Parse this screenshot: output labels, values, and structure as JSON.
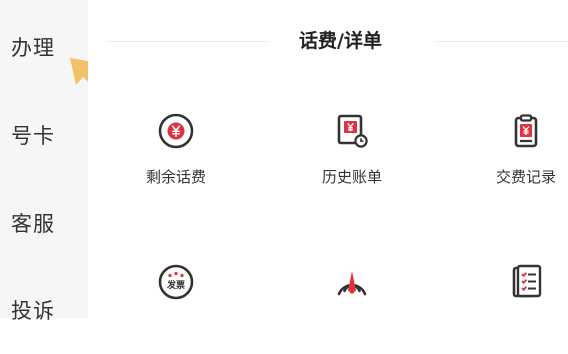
{
  "sidebar": {
    "items": [
      {
        "label": "办理"
      },
      {
        "label": "号卡"
      },
      {
        "label": "客服"
      },
      {
        "label": "投诉"
      }
    ]
  },
  "section": {
    "title": "话费/详单",
    "tiles": [
      {
        "label": "剩余话费",
        "icon": "yuan-circle-icon"
      },
      {
        "label": "历史账单",
        "icon": "bill-history-icon"
      },
      {
        "label": "交费记录",
        "icon": "payment-record-icon"
      },
      {
        "label": "",
        "icon": "invoice-icon",
        "icon_text": "发票"
      },
      {
        "label": "",
        "icon": "signal-gauge-icon"
      },
      {
        "label": "",
        "icon": "checklist-icon"
      }
    ]
  },
  "colors": {
    "accent": "#e0313f",
    "icon_dark": "#333333",
    "sidebar_bg": "#f6f6f7",
    "pointer": "#f2c26b"
  }
}
